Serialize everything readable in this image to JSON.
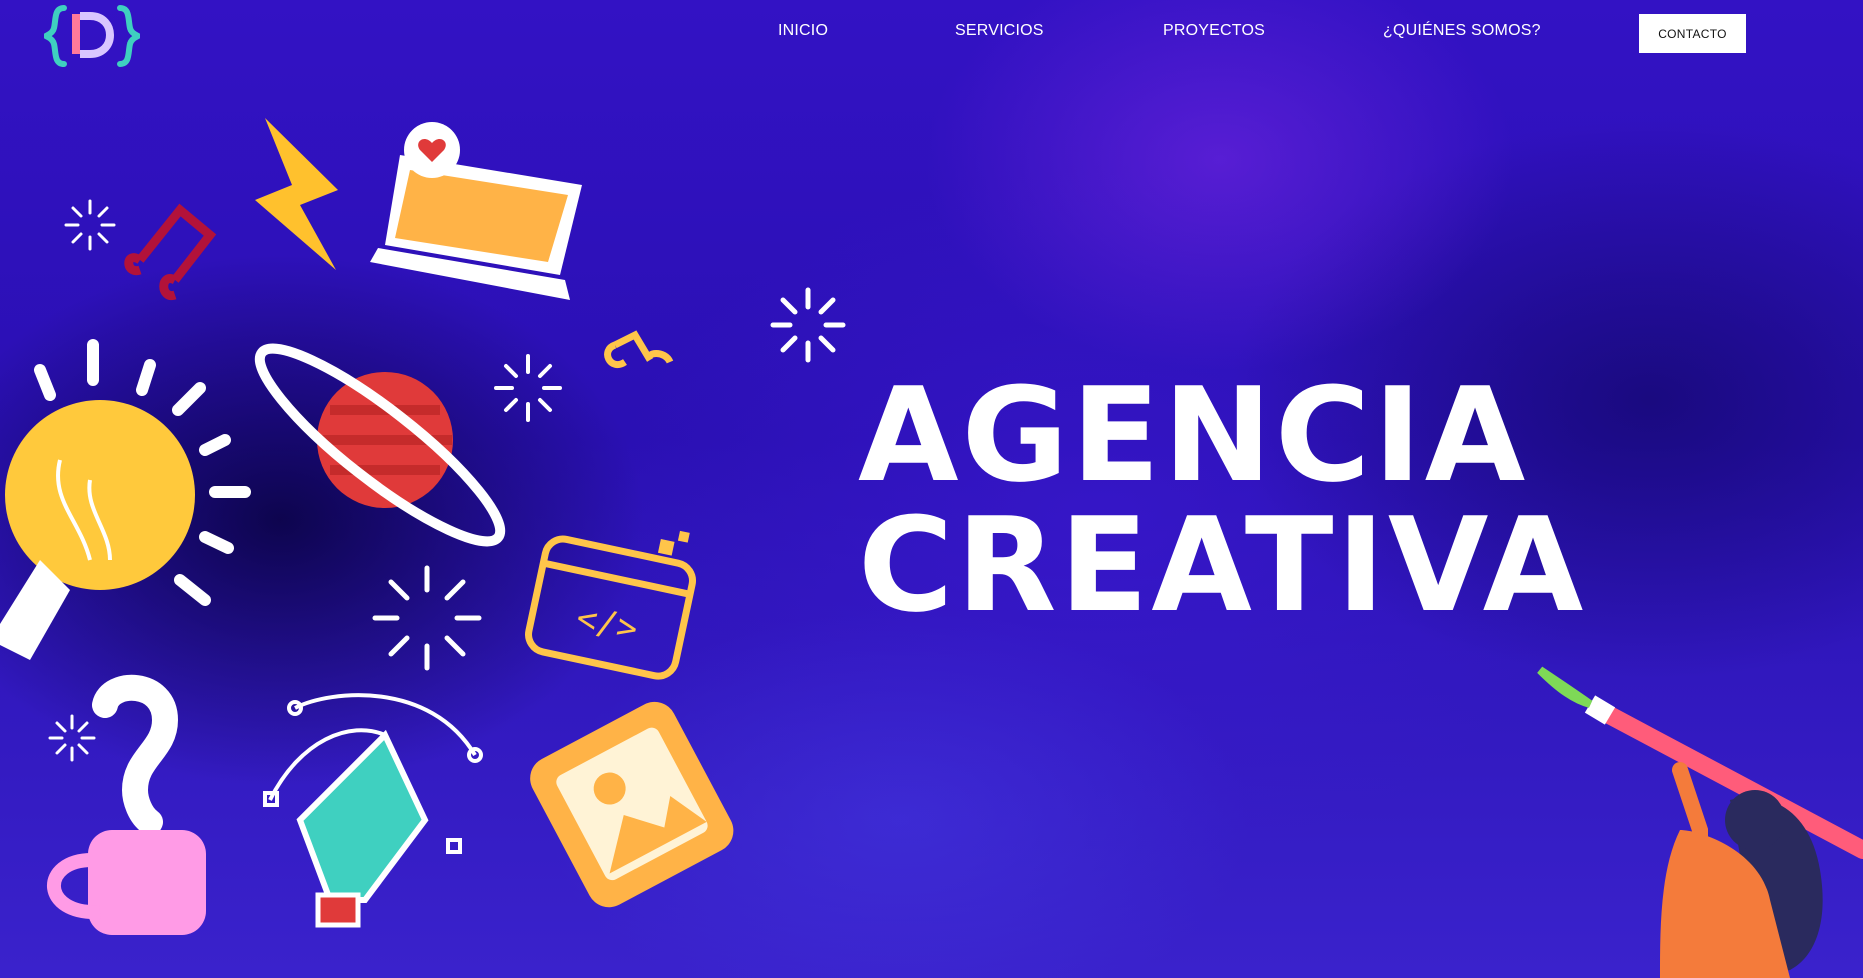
{
  "logo": {
    "text": "D",
    "icon": "brand-logo-icon"
  },
  "nav": {
    "items": [
      {
        "label": "INICIO"
      },
      {
        "label": "SERVICIOS"
      },
      {
        "label": "PROYECTOS"
      },
      {
        "label": "¿QUIÉNES SOMOS?"
      }
    ],
    "cta": "CONTACTO"
  },
  "hero": {
    "line1": "AGENCIA",
    "line2": "CREATIVA"
  },
  "colors": {
    "background": "#2a10b3",
    "accent_yellow": "#ffc54a",
    "accent_red": "#e03a3a",
    "accent_teal": "#3fd0c0",
    "accent_pink": "#ff9be6"
  },
  "illustrations": [
    "lightbulb-icon",
    "planet-icon",
    "laptop-heart-icon",
    "lightning-icon",
    "music-note-icon",
    "code-window-icon",
    "question-mark-icon",
    "mug-icon",
    "pen-tool-icon",
    "image-icon",
    "sparkle-icon",
    "painter-character"
  ]
}
